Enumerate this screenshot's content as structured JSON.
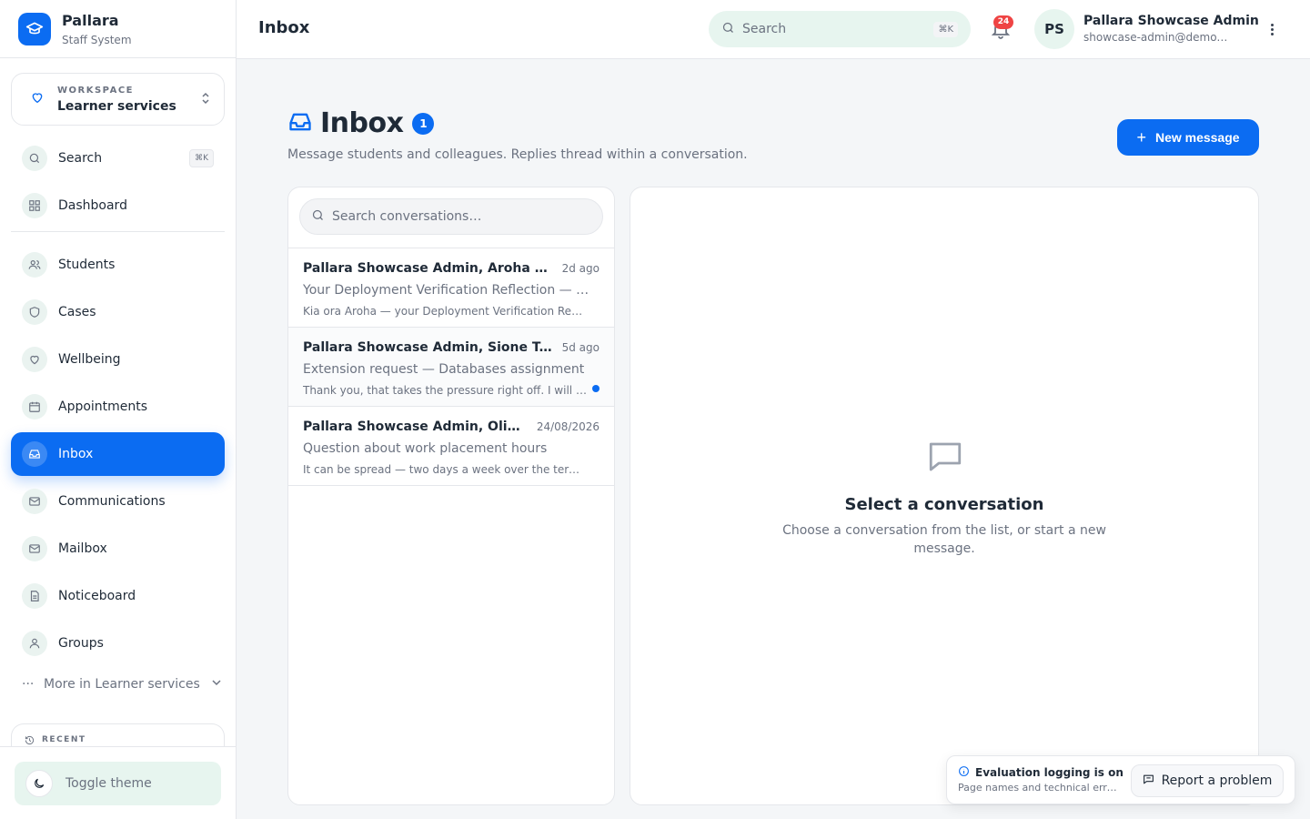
{
  "brand": {
    "name": "Pallara",
    "subtitle": "Staff System"
  },
  "workspace": {
    "label": "WORKSPACE",
    "value": "Learner services"
  },
  "sidebar": {
    "search": {
      "label": "Search",
      "shortcut": "⌘K"
    },
    "items": [
      {
        "label": "Dashboard",
        "icon": "grid-icon"
      },
      {
        "label": "Students",
        "icon": "users-icon"
      },
      {
        "label": "Cases",
        "icon": "shield-icon"
      },
      {
        "label": "Wellbeing",
        "icon": "heart-icon"
      },
      {
        "label": "Appointments",
        "icon": "calendar-icon"
      },
      {
        "label": "Inbox",
        "icon": "inbox-icon",
        "active": true
      },
      {
        "label": "Communications",
        "icon": "mail-icon"
      },
      {
        "label": "Mailbox",
        "icon": "mail-icon"
      },
      {
        "label": "Noticeboard",
        "icon": "document-icon"
      },
      {
        "label": "Groups",
        "icon": "user-icon"
      }
    ],
    "more_label": "More in Learner services",
    "recent_label": "RECENT",
    "toggle_theme": "Toggle theme"
  },
  "topbar": {
    "title": "Inbox",
    "search_placeholder": "Search",
    "search_shortcut": "⌘K",
    "notification_count": "24",
    "user": {
      "initials": "PS",
      "name": "Pallara Showcase Admin",
      "email": "showcase-admin@demo.pallara"
    }
  },
  "page": {
    "title": "Inbox",
    "badge": "1",
    "subtitle": "Message students and colleagues. Replies thread within a conversation.",
    "new_message": "New message"
  },
  "conversations": {
    "search_placeholder": "Search conversations…",
    "items": [
      {
        "names": "Pallara Showcase Admin, Aroha Te Wiata",
        "date": "2d ago",
        "subject": "Your Deployment Verification Reflection — marked",
        "preview": "Kia ora Aroha — your Deployment Verification Reflection has been marked",
        "unread": false
      },
      {
        "names": "Pallara Showcase Admin, Sione Taufa",
        "date": "5d ago",
        "subject": "Extension request — Databases assignment",
        "preview": "Thank you, that takes the pressure right off. I will send it through",
        "unread": true
      },
      {
        "names": "Pallara Showcase Admin, Olivia Thompson",
        "date": "24/08/2026",
        "subject": "Question about work placement hours",
        "preview": "It can be spread — two days a week over the term is fine",
        "unread": false
      }
    ]
  },
  "detail": {
    "empty_title": "Select a conversation",
    "empty_subtitle": "Choose a conversation from the list, or start a new message."
  },
  "notice": {
    "title": "Evaluation logging is on",
    "subtitle": "Page names and technical errors are logged",
    "report_label": "Report a problem"
  },
  "colors": {
    "accent": "#0b6cf2",
    "mint": "#e7f5ef",
    "badge": "#ef4444"
  }
}
